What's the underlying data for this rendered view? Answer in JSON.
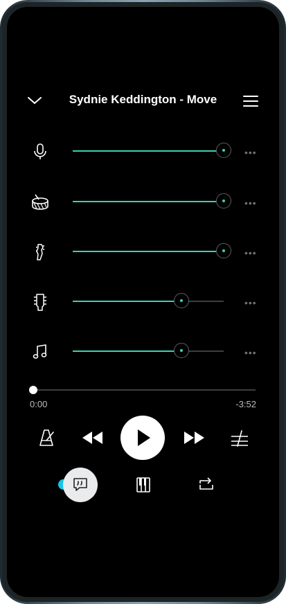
{
  "header": {
    "title": "Sydnie Keddington - Move"
  },
  "tracks": [
    {
      "name": "vocals",
      "icon": "microphone-icon",
      "level": 1.0
    },
    {
      "name": "drums",
      "icon": "drum-icon",
      "level": 1.0
    },
    {
      "name": "bass",
      "icon": "bass-guitar-icon",
      "level": 1.0
    },
    {
      "name": "guitar",
      "icon": "guitar-headstock-icon",
      "level": 0.72
    },
    {
      "name": "other",
      "icon": "music-note-icon",
      "level": 0.72
    }
  ],
  "playback": {
    "elapsed": "0:00",
    "remaining": "-3:52",
    "progress": 0.0
  },
  "colors": {
    "accent": "#3fd1b5",
    "track": "#3b3f42",
    "lyrics_dot": "#19c4e6"
  }
}
